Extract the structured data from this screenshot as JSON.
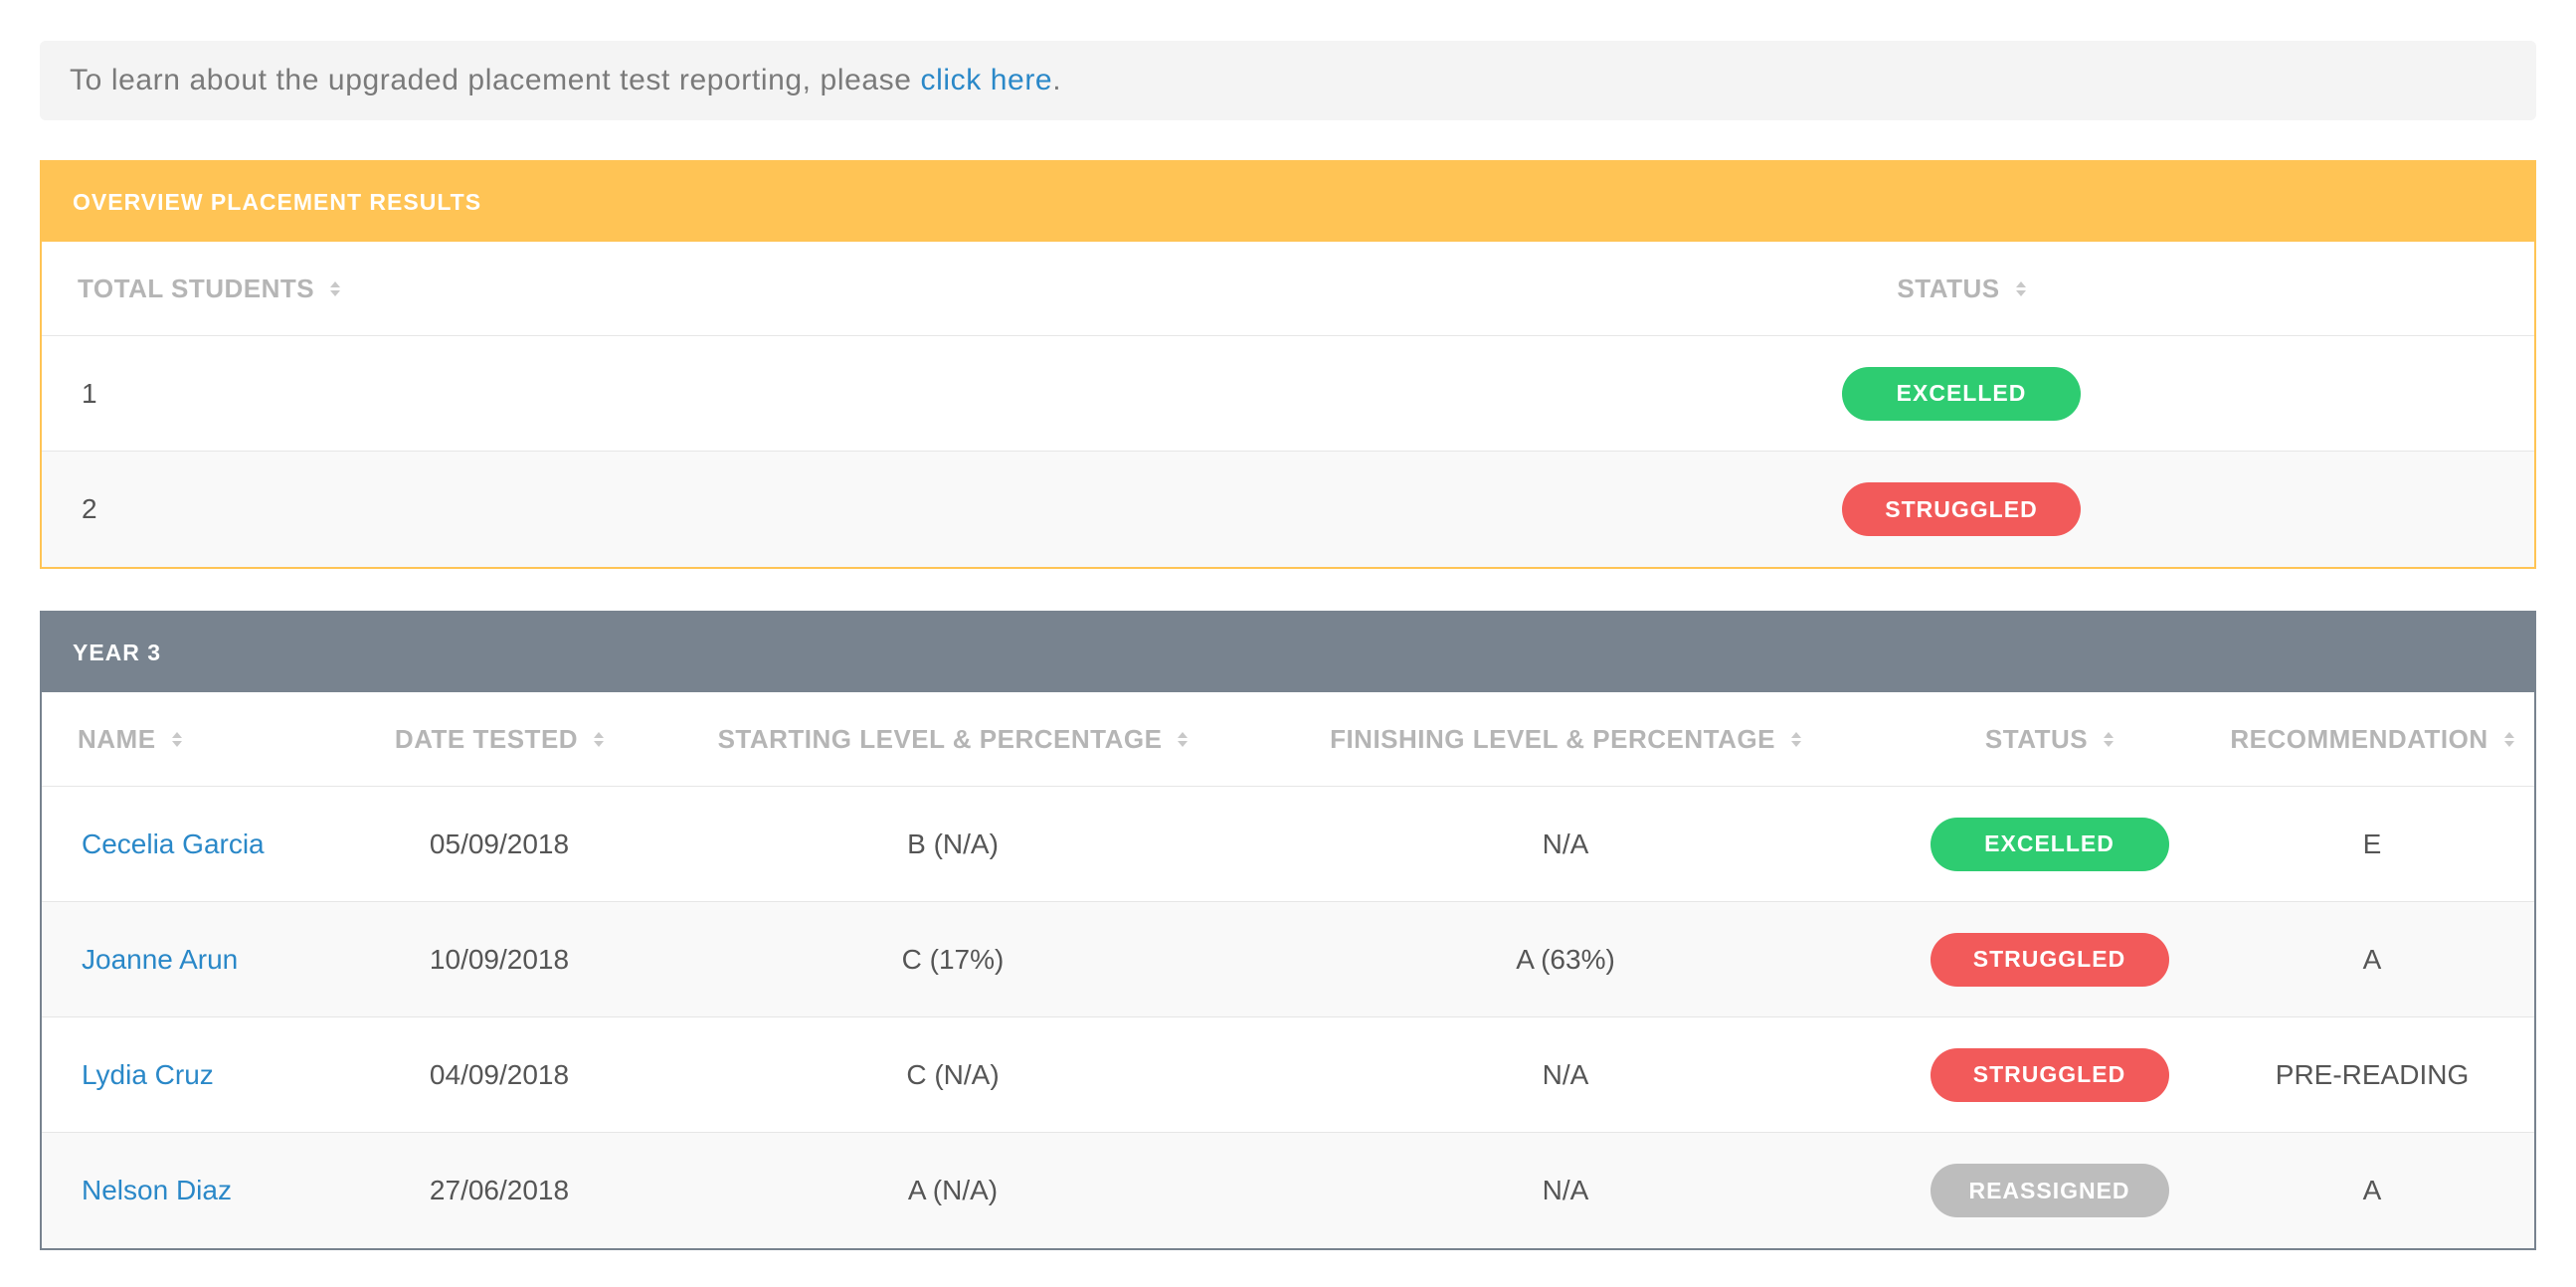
{
  "notice": {
    "text": "To learn about the upgraded placement test reporting, please ",
    "link": "click here",
    "end": "."
  },
  "overview": {
    "title": "OVERVIEW PLACEMENT RESULTS",
    "headers": {
      "total": "TOTAL STUDENTS",
      "status": "STATUS"
    },
    "rows": [
      {
        "total": "1",
        "status": "EXCELLED"
      },
      {
        "total": "2",
        "status": "STRUGGLED"
      }
    ]
  },
  "year": {
    "title": "YEAR 3",
    "headers": {
      "name": "NAME",
      "date": "DATE TESTED",
      "start": "STARTING LEVEL & PERCENTAGE",
      "finish": "FINISHING LEVEL & PERCENTAGE",
      "status": "STATUS",
      "recommendation": "RECOMMENDATION"
    },
    "rows": [
      {
        "name": "Cecelia Garcia",
        "date": "05/09/2018",
        "start": "B (N/A)",
        "finish": "N/A",
        "status": "EXCELLED",
        "recommendation": "E"
      },
      {
        "name": "Joanne Arun",
        "date": "10/09/2018",
        "start": "C (17%)",
        "finish": "A (63%)",
        "status": "STRUGGLED",
        "recommendation": "A"
      },
      {
        "name": "Lydia Cruz",
        "date": "04/09/2018",
        "start": "C (N/A)",
        "finish": "N/A",
        "status": "STRUGGLED",
        "recommendation": "PRE-READING"
      },
      {
        "name": "Nelson Diaz",
        "date": "27/06/2018",
        "start": "A (N/A)",
        "finish": "N/A",
        "status": "REASSIGNED",
        "recommendation": "A"
      }
    ]
  },
  "colors": {
    "overview_header": "#ffc455",
    "year_header": "#78838f",
    "excelled": "#2ecc71",
    "struggled": "#f25a5a",
    "reassigned": "#bdbdbd",
    "link": "#2a88c8"
  }
}
